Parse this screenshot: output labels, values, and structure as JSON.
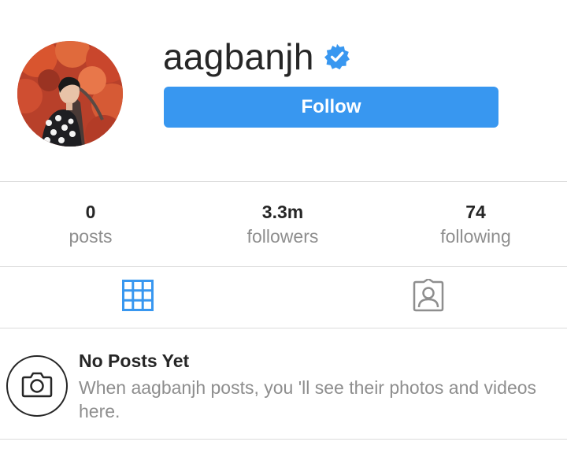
{
  "profile": {
    "username": "aagbanjh",
    "verified_icon": "verified-badge-icon",
    "follow_label": "Follow",
    "accent_color": "#3897f0"
  },
  "stats": [
    {
      "value": "0",
      "label": "posts"
    },
    {
      "value": "3.3m",
      "label": "followers"
    },
    {
      "value": "74",
      "label": "following"
    }
  ],
  "tabs": [
    {
      "icon": "grid-icon",
      "active": true
    },
    {
      "icon": "tagged-user-icon",
      "active": false
    }
  ],
  "empty_state": {
    "icon": "camera-icon",
    "title": "No Posts Yet",
    "message": "When aagbanjh posts, you 'll see their photos and videos here."
  }
}
